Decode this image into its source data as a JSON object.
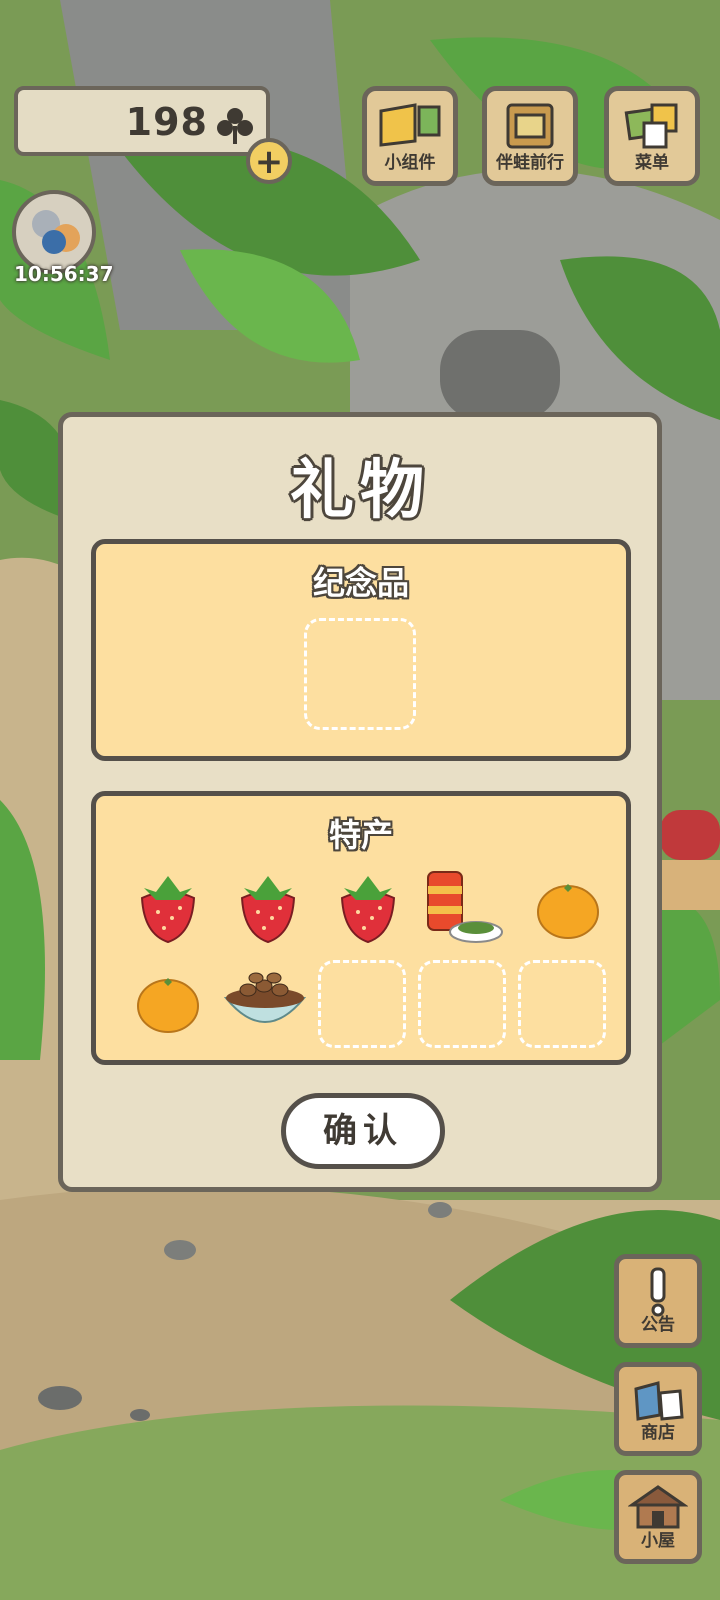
{
  "hud": {
    "clover_count": "198",
    "clock": "10:56:37",
    "add_symbol": "+"
  },
  "top_buttons": [
    {
      "label": "小组件",
      "icon": "widget-icon"
    },
    {
      "label": "伴蛙前行",
      "icon": "frog-journey-icon"
    },
    {
      "label": "菜单",
      "icon": "menu-cards-icon"
    }
  ],
  "side_buttons": [
    {
      "label": "公告",
      "icon": "exclamation-icon"
    },
    {
      "label": "商店",
      "icon": "shop-bags-icon"
    },
    {
      "label": "小屋",
      "icon": "house-icon"
    }
  ],
  "dialog": {
    "title": "礼物",
    "souvenir_panel": {
      "title": "纪念品",
      "slots": [
        "empty"
      ]
    },
    "specialty_panel": {
      "title": "特产",
      "items": [
        "strawberry",
        "strawberry",
        "strawberry",
        "canned-drink-with-plate",
        "orange",
        "orange",
        "nut-bowl",
        "empty",
        "empty",
        "empty"
      ]
    },
    "confirm_label": "确认"
  },
  "colors": {
    "panel_fill": "#fddfa0",
    "dialog_fill": "#e8dfc6",
    "outline": "#55504a"
  }
}
